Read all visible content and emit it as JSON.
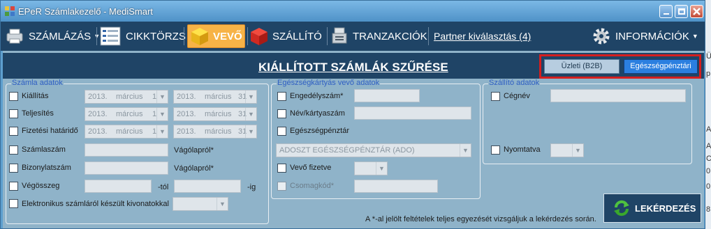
{
  "window": {
    "title": "EPeR Számlakezelő - MediSmart"
  },
  "toolbar": {
    "items": [
      {
        "label": "SZÁMLÁZÁS",
        "icon": "printer-icon",
        "dropdown": true
      },
      {
        "label": "CIKKTÖRZS",
        "icon": "list-icon"
      },
      {
        "label": "VEVŐ",
        "icon": "yellow-cube-icon",
        "active": true
      },
      {
        "label": "SZÁLLÍTÓ",
        "icon": "red-cube-icon"
      },
      {
        "label": "TRANZAKCIÓK",
        "icon": "cash-register-icon"
      }
    ],
    "partner_link": "Partner kiválasztás (4)",
    "info": {
      "label": "INFORMÁCIÓK",
      "icon": "gear-icon",
      "dropdown": true
    }
  },
  "header": {
    "title": "KIÁLLÍTOTT SZÁMLÁK SZŰRÉSE",
    "toggle_b2b": "Üzleti (B2B)",
    "toggle_eg": "Egészségpénztári"
  },
  "szamla": {
    "legend": "Számla adatok",
    "kiallitas": "Kiállítás",
    "teljesites": "Teljesítés",
    "fizetesi": "Fizetési határidő",
    "szamlaszam": "Számlaszám",
    "bizonylatszam": "Bizonylatszám",
    "vegosszeg": "Végösszeg",
    "elektronikus": "Elektronikus számláról készült kivonatokkal",
    "vagolaprol1": "Vágólapról*",
    "vagolaprol2": "Vágólapról*",
    "tol": "-tól",
    "ig": "-ig",
    "date_year": "2013.",
    "date_month": "március",
    "date_from_day": "1",
    "date_to_day": "31"
  },
  "egeszseg": {
    "legend": "Egészségkártyás vevő adatok",
    "engedelyszam": "Engedélyszám*",
    "nev_kartyaszam": "Név/kártyaszám",
    "egeszsegpenztar": "Egészségpénztár",
    "penztar_select": "ADOSZT EGÉSZSÉGPÉNZTÁR (ADO)",
    "vevo_fizetve": "Vevő fizetve",
    "csomagkod": "Csomagkód*"
  },
  "szallito": {
    "legend": "Szállító adatok",
    "cegnev": "Cégnév",
    "nyomtatva": "Nyomtatva"
  },
  "note": "A *-al jelölt feltételek teljes egyezését vizsgáljuk a lekérdezés során.",
  "query_button": "LEKÉRDEZÉS",
  "edge_letters": [
    "Ü",
    "p",
    "A",
    "A",
    "C",
    "0",
    "0",
    "8"
  ]
}
